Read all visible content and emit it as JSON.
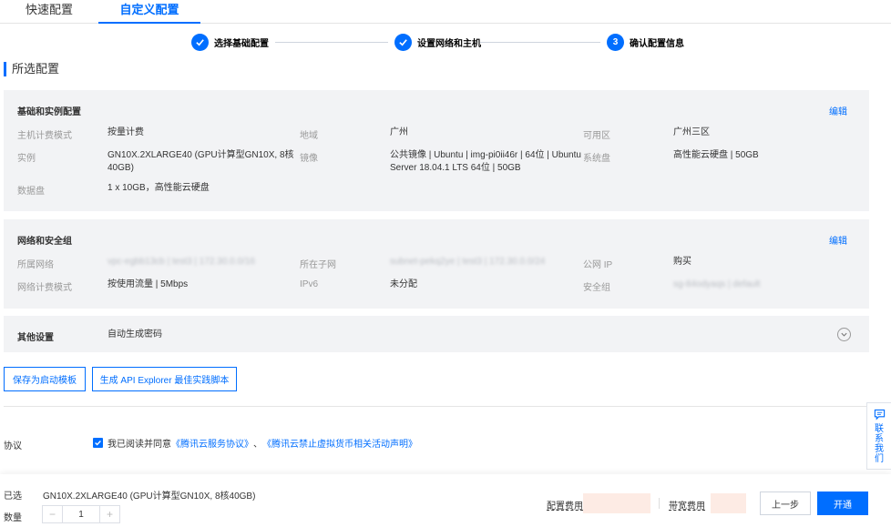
{
  "tabs": [
    {
      "label": "快速配置"
    },
    {
      "label": "自定义配置"
    }
  ],
  "steps": [
    {
      "number": "1",
      "label": "选择基础配置",
      "done": true
    },
    {
      "number": "2",
      "label": "设置网络和主机",
      "done": true
    },
    {
      "number": "3",
      "label": "确认配置信息",
      "done": false
    }
  ],
  "section_title": "所选配置",
  "basic": {
    "header": "基础和实例配置",
    "edit": "编辑",
    "billing_label": "主机计费模式",
    "billing_value": "按量计费",
    "region_label": "地域",
    "region_value": "广州",
    "zone_label": "可用区",
    "zone_value": "广州三区",
    "instance_label": "实例",
    "instance_value_1": "GN10X.2XLARGE40 (GPU计算型GN10X, 8核",
    "instance_value_2": "40GB)",
    "image_label": "镜像",
    "image_value_1": "公共镜像 | Ubuntu | img-pi0ii46r | 64位 | Ubuntu",
    "image_value_2": "Server 18.04.1 LTS 64位 | 50GB",
    "sysdisk_label": "系统盘",
    "sysdisk_value": "高性能云硬盘 | 50GB",
    "datadisk_label": "数据盘",
    "datadisk_value": "1 x 10GB，高性能云硬盘"
  },
  "network": {
    "header": "网络和安全组",
    "edit": "编辑",
    "vpc_label": "所属网络",
    "vpc_value": "vpc-egbb13cb | test3 | 172.30.0.0/16",
    "subnet_label": "所在子网",
    "subnet_value": "subnet-pekq2ye | test3 | 172.30.0.0/24",
    "publicip_label": "公网 IP",
    "publicip_value": "购买",
    "netbilling_label": "网络计费模式",
    "netbilling_value": "按使用流量 | 5Mbps",
    "ipv6_label": "IPv6",
    "ipv6_value": "未分配",
    "sg_label": "安全组",
    "sg_value": "sg-84odyaqs | default"
  },
  "other": {
    "label": "其他设置",
    "value": "自动生成密码"
  },
  "buttons": {
    "save_template": "保存为启动模板",
    "api_explorer": "生成 API Explorer 最佳实践脚本"
  },
  "agreement": {
    "label": "协议",
    "text": "我已阅读并同意",
    "link1": "《腾讯云服务协议》",
    "sep": "、",
    "link2": "《腾讯云禁止虚拟货币相关活动声明》",
    "checked": true
  },
  "contact": {
    "text": "联系我们"
  },
  "bottom": {
    "selected_label": "已选",
    "selected_value": "GN10X.2XLARGE40 (GPU计算型GN10X, 8核40GB)",
    "quantity_label": "数量",
    "quantity_value": "1",
    "minus": "−",
    "plus": "+",
    "config_fee_label": "配置费用",
    "bandwidth_fee_label": "带宽费用",
    "prev": "上一步",
    "open": "开通"
  },
  "colors": {
    "accent": "#006eff",
    "panel_bg": "#f2f3f5",
    "fee_bg": "#fdebe4"
  }
}
